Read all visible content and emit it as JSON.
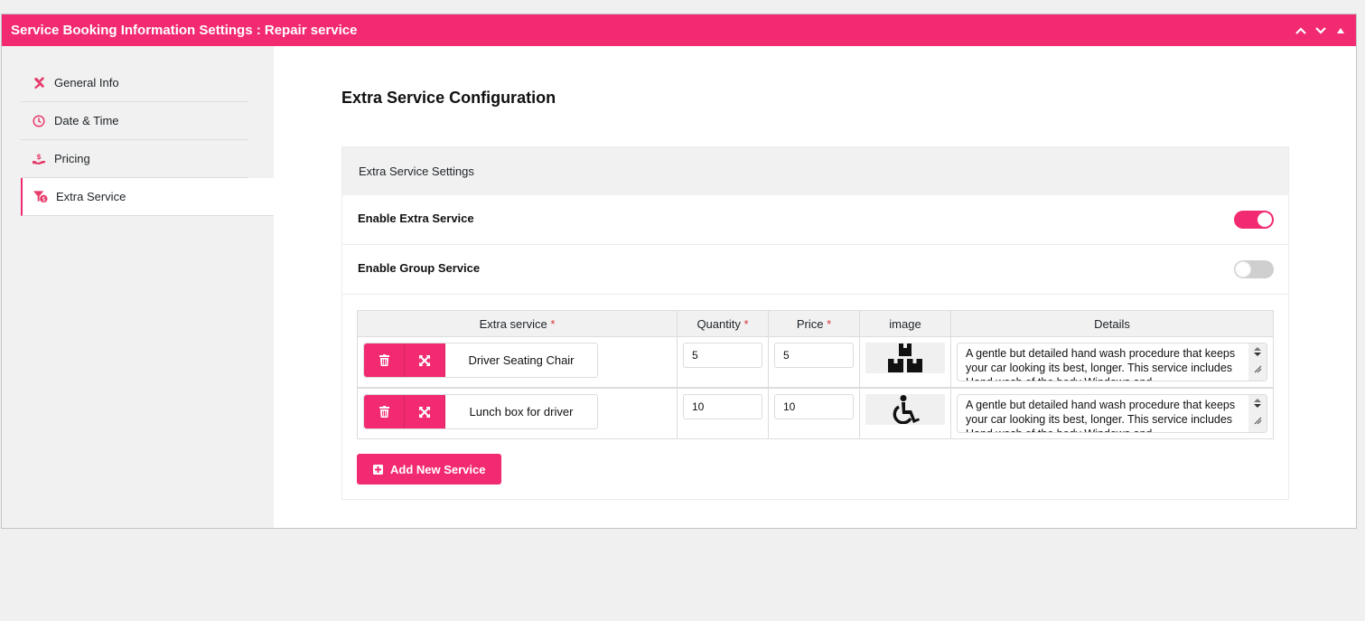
{
  "panel": {
    "title": "Service Booking Information Settings : Repair service",
    "controls": [
      "chevron-up-icon",
      "chevron-down-icon",
      "triangle-up-icon"
    ],
    "accent_color": "#f22a72"
  },
  "sidebar": {
    "items": [
      {
        "label": "General Info",
        "icon": "tools-icon",
        "active": false
      },
      {
        "label": "Date & Time",
        "icon": "clock-icon",
        "active": false
      },
      {
        "label": "Pricing",
        "icon": "hand-dollar-icon",
        "active": false
      },
      {
        "label": "Extra Service",
        "icon": "filter-dollar-icon",
        "active": true
      }
    ]
  },
  "main": {
    "title": "Extra Service Configuration",
    "settings_heading": "Extra Service Settings",
    "settings": [
      {
        "label": "Enable Extra Service",
        "enabled": true
      },
      {
        "label": "Enable Group Service",
        "enabled": false
      }
    ],
    "table": {
      "columns": [
        {
          "label": "Extra service",
          "required": "*"
        },
        {
          "label": "Quantity",
          "required": "*"
        },
        {
          "label": "Price",
          "required": "*"
        },
        {
          "label": "image",
          "required": ""
        },
        {
          "label": "Details",
          "required": ""
        }
      ],
      "rows": [
        {
          "name": "Driver Seating Chair",
          "quantity": "5",
          "price": "5",
          "image_icon": "boxes-stacked-icon",
          "details": "A gentle but detailed hand wash procedure that keeps your car looking its best, longer. This service includes Hand wash of the body Windows and"
        },
        {
          "name": "Lunch box for driver",
          "quantity": "10",
          "price": "10",
          "image_icon": "wheelchair-icon",
          "details": "A gentle but detailed hand wash procedure that keeps your car looking its best, longer. This service includes Hand wash of the body Windows and"
        }
      ]
    },
    "add_button": "Add New Service"
  }
}
